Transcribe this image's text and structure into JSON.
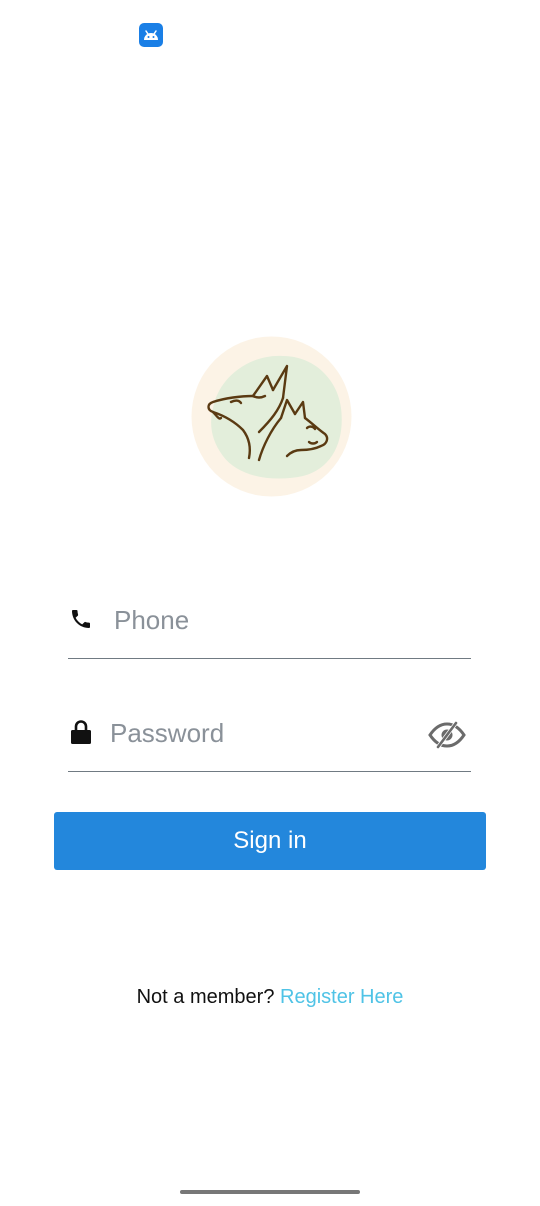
{
  "status_bar": {
    "app_icon": "android-app-icon"
  },
  "logo": {
    "icon": "dog-and-cat-logo"
  },
  "phone_field": {
    "icon": "phone-icon",
    "placeholder": "Phone",
    "value": ""
  },
  "password_field": {
    "icon": "lock-icon",
    "placeholder": "Password",
    "value": "",
    "toggle_icon": "eye-off-icon"
  },
  "sign_in_button": {
    "label": "Sign in"
  },
  "register": {
    "prompt": "Not a member? ",
    "link_label": "Register Here"
  },
  "colors": {
    "primary": "#2387dc",
    "link": "#4fc3e6",
    "logo_outer": "#fcf3e6",
    "logo_inner": "#e3eedb",
    "logo_stroke": "#5a3a12",
    "app_icon_bg": "#1a7fe6"
  }
}
